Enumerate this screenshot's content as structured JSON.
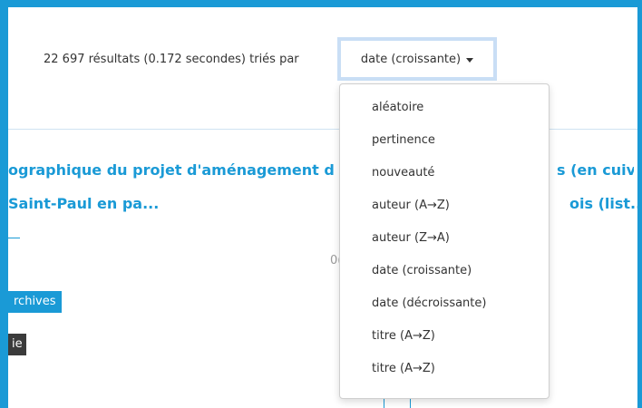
{
  "results": {
    "summary": "22 697 résultats (0.172 secondes) triés par"
  },
  "sort": {
    "selected": "date (croissante)",
    "options": [
      "aléatoire",
      "pertinence",
      "nouveauté",
      "auteur (A→Z)",
      "auteur (Z→A)",
      "date (croissante)",
      "date (décroissante)",
      "titre (A→Z)",
      "titre (A→Z)"
    ]
  },
  "result_item": {
    "title_line1": "ographique du projet d'aménagement d",
    "title_line1_right": "s (en cuivre",
    "title_line2": " Saint-Paul en pa...",
    "title_line2_right": "ois (list...",
    "partial_number": "0(",
    "tag_archives": "rchives",
    "tag_dark": "ie"
  },
  "colors": {
    "accent": "#1a9ad6",
    "dark_tag": "#3b3b3b",
    "focus_border": "#c9def5"
  }
}
